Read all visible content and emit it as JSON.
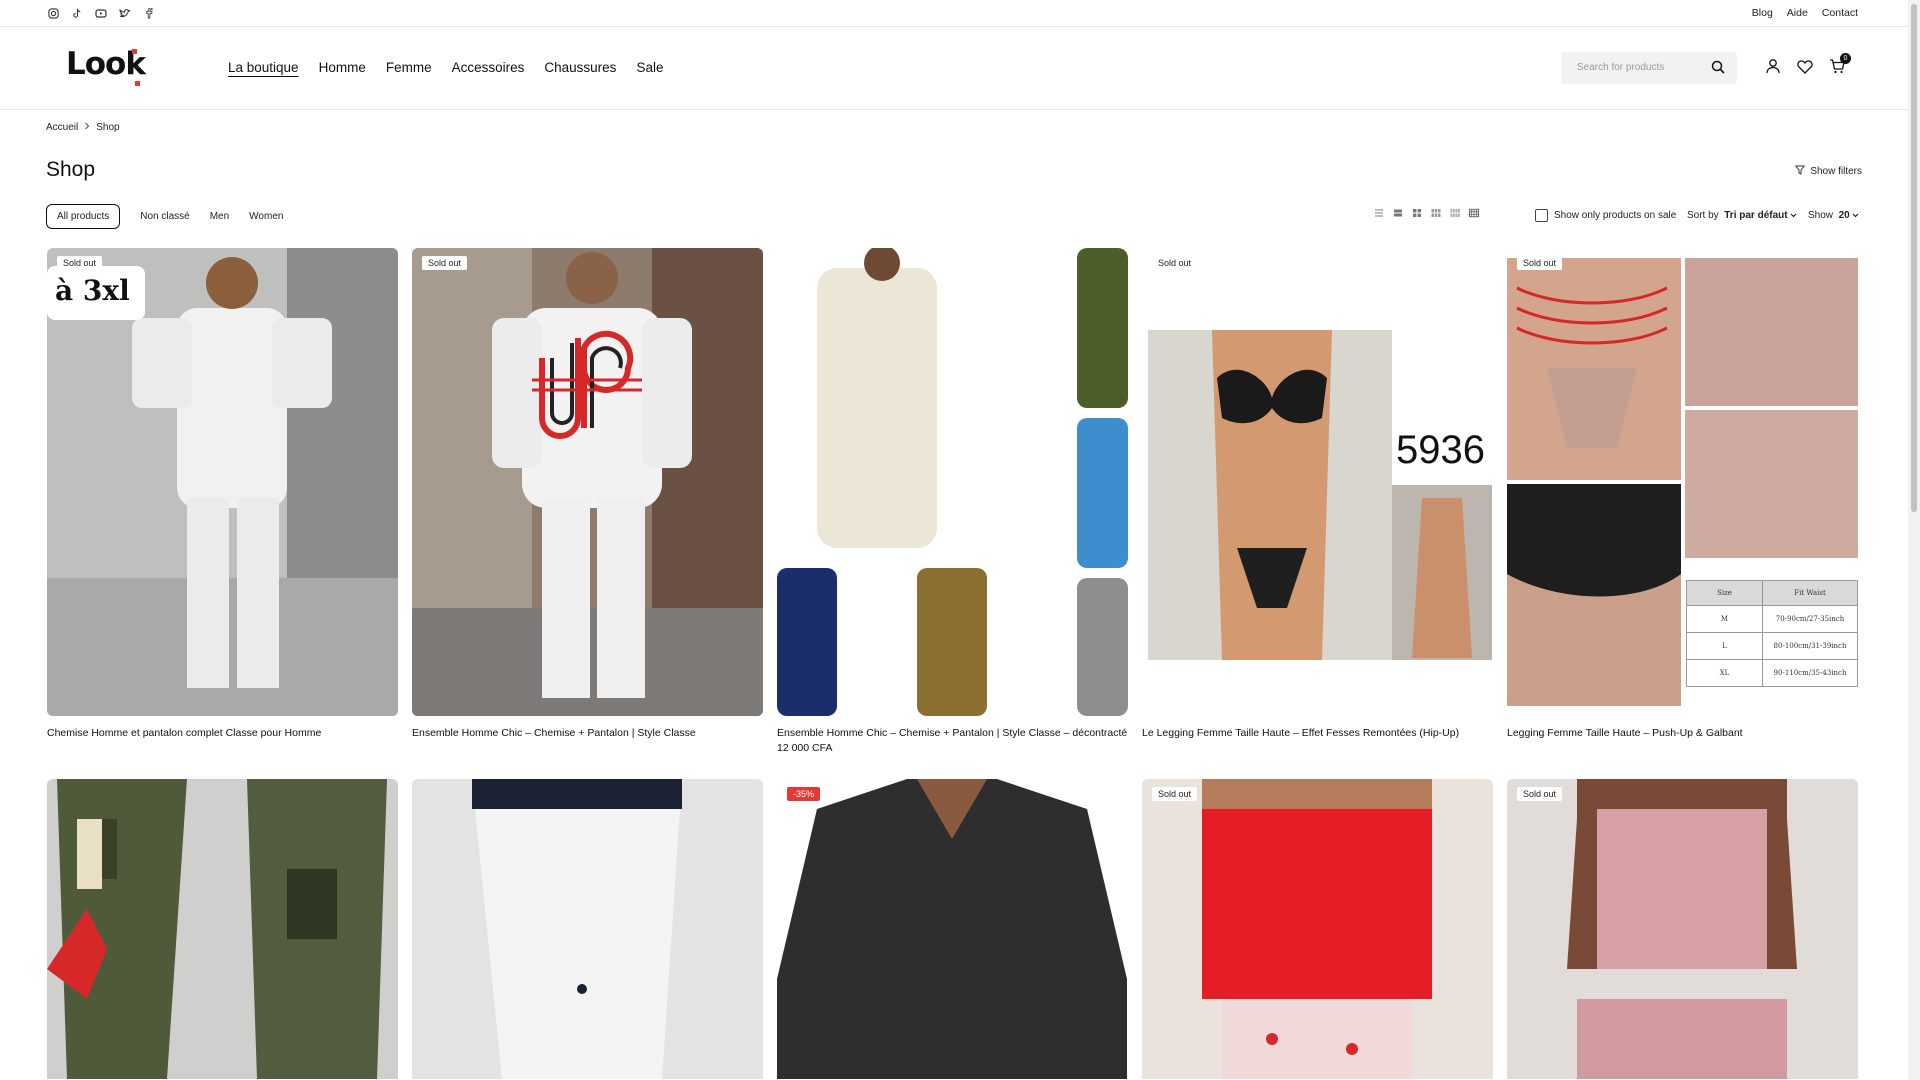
{
  "topbar": {
    "socials": [
      "instagram-icon",
      "tiktok-icon",
      "youtube-icon",
      "twitter-icon",
      "facebook-icon"
    ],
    "links": [
      "Blog",
      "Aide",
      "Contact"
    ]
  },
  "header": {
    "logo_text": "Look",
    "nav": [
      "La boutique",
      "Homme",
      "Femme",
      "Accessoires",
      "Chaussures",
      "Sale"
    ],
    "search_placeholder": "Search for products",
    "cart_count": "0"
  },
  "breadcrumb": [
    "Accueil",
    "Shop"
  ],
  "page_title": "Shop",
  "show_filters": "Show filters",
  "categories": [
    "All products",
    "Non classé",
    "Men",
    "Women"
  ],
  "toolbar": {
    "sale_only_label": "Show only products on sale",
    "sort_label": "Sort by",
    "sort_value": "Tri par défaut",
    "show_label": "Show",
    "show_value": "20"
  },
  "products_row1": [
    {
      "name": "Chemise Homme et pantalon complet Classe pour Homme",
      "badge": "Sold out",
      "overlay": "à 3xl",
      "price": ""
    },
    {
      "name": "Ensemble Homme Chic – Chemise + Pantalon | Style Classe",
      "badge": "Sold out",
      "price": ""
    },
    {
      "name": "Ensemble Homme Chic – Chemise + Pantalon | Style Classe – décontracté",
      "badge": "",
      "price": "12 000 CFA"
    },
    {
      "name": "Le Legging Femme Taille Haute – Effet Fesses Remontées (Hip-Up)",
      "badge": "Sold out",
      "overlay": "5936",
      "price": ""
    },
    {
      "name": "Legging Femme Taille Haute – Push-Up & Galbant",
      "badge": "Sold out",
      "price": "",
      "size_table": {
        "headers": [
          "Size",
          "Fit Waist"
        ],
        "rows": [
          [
            "M",
            "70-90cm/27-35inch"
          ],
          [
            "L",
            "80-100cm/31-39inch"
          ],
          [
            "XL",
            "90-110cm/35-43inch"
          ]
        ]
      }
    }
  ],
  "products_row2": [
    {
      "badge": ""
    },
    {
      "badge": ""
    },
    {
      "badge": "-35%"
    },
    {
      "badge": "Sold out"
    },
    {
      "badge": "Sold out"
    }
  ],
  "colors": {
    "accent": "#e53935",
    "text": "#111111",
    "border": "#e5e5e5"
  }
}
